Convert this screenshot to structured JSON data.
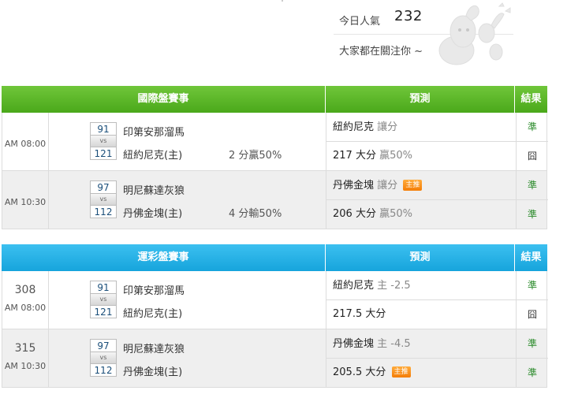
{
  "header": {
    "visitors_label": "今日人氣",
    "visitors_count": "232",
    "follow_text": "大家都在關注你 ~"
  },
  "colors": {
    "green_header": "#5cb82a",
    "blue_header": "#22aee6",
    "badge": "#f5860f",
    "win": "#2a8a2a"
  },
  "tables": [
    {
      "title": "國際盤賽事",
      "pred_header": "預測",
      "result_header": "結果",
      "matches": [
        {
          "num": "",
          "time": "AM 08:00",
          "away_score": "91",
          "home_score": "121",
          "vs": "vs",
          "away": "印第安那溜馬",
          "home": "紐約尼克(主)",
          "tip": "2 分贏50%",
          "pred1_main": "紐約尼克",
          "pred1_sub": "讓分",
          "pred1_badge": "",
          "res1": "準",
          "pred2_main": "217 大分",
          "pred2_sub": "贏50%",
          "pred2_badge": "",
          "res2": "囧"
        },
        {
          "num": "",
          "time": "AM 10:30",
          "away_score": "97",
          "home_score": "112",
          "vs": "vs",
          "away": "明尼蘇達灰狼",
          "home": "丹佛金塊(主)",
          "tip": "4 分輸50%",
          "pred1_main": "丹佛金塊",
          "pred1_sub": "讓分",
          "pred1_badge": "主推",
          "res1": "準",
          "pred2_main": "206 大分",
          "pred2_sub": "贏50%",
          "pred2_badge": "",
          "res2": "準"
        }
      ]
    },
    {
      "title": "運彩盤賽事",
      "pred_header": "預測",
      "result_header": "結果",
      "matches": [
        {
          "num": "308",
          "time": "AM 08:00",
          "away_score": "91",
          "home_score": "121",
          "vs": "vs",
          "away": "印第安那溜馬",
          "home": "紐約尼克(主)",
          "tip": "",
          "pred1_main": "紐約尼克",
          "pred1_sub": "主 -2.5",
          "pred1_badge": "",
          "res1": "準",
          "pred2_main": "217.5 大分",
          "pred2_sub": "",
          "pred2_badge": "",
          "res2": "囧"
        },
        {
          "num": "315",
          "time": "AM 10:30",
          "away_score": "97",
          "home_score": "112",
          "vs": "vs",
          "away": "明尼蘇達灰狼",
          "home": "丹佛金塊(主)",
          "tip": "",
          "pred1_main": "丹佛金塊",
          "pred1_sub": "主 -4.5",
          "pred1_badge": "",
          "res1": "準",
          "pred2_main": "205.5 大分",
          "pred2_sub": "",
          "pred2_badge": "主推",
          "res2": "準"
        }
      ]
    }
  ]
}
